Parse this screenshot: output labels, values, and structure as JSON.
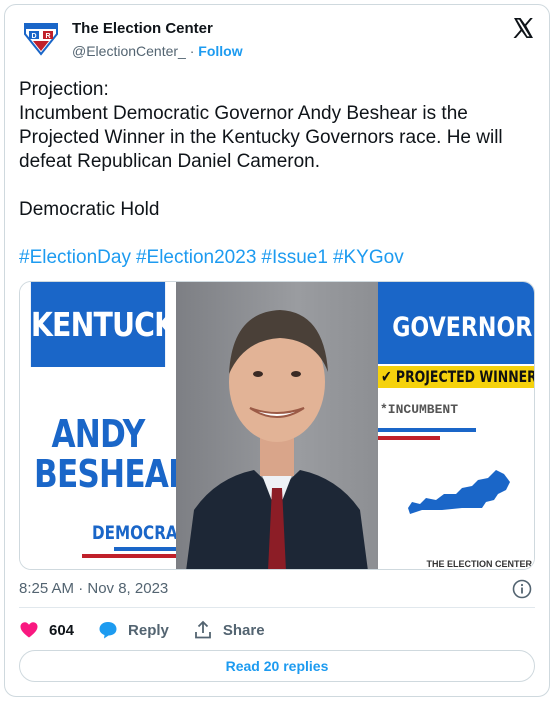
{
  "header": {
    "display_name": "The Election Center",
    "handle": "@ElectionCenter_",
    "separator": "·",
    "follow_label": "Follow"
  },
  "tweet": {
    "lines": [
      "Projection:",
      "Incumbent Democratic Governor Andy Beshear is the Projected Winner in the Kentucky Governors race. He will defeat Republican Daniel Cameron.",
      "",
      "Democratic Hold"
    ],
    "hashtags": [
      "#ElectionDay",
      "#Election2023",
      "#Issue1",
      "#KYGov"
    ]
  },
  "media": {
    "state_banner": "KENTUCKY",
    "first_name": "ANDY",
    "last_name": "BESHEAR",
    "party": "DEMOCRAT",
    "office": "GOVERNOR",
    "status_check": "✔",
    "status": "PROJECTED WINNER",
    "incumbent": "*INCUMBENT",
    "credit": "THE ELECTION CENTER",
    "colors": {
      "blue": "#1a66c8",
      "red": "#c0202a",
      "yellow": "#f5d20d"
    }
  },
  "meta": {
    "timestamp": "8:25 AM · Nov 8, 2023"
  },
  "actions": {
    "like_count": "604",
    "reply_label": "Reply",
    "share_label": "Share",
    "read_replies_label": "Read 20 replies"
  },
  "icons": {
    "avatar": "election-center-logo",
    "x": "x-logo-icon",
    "info": "info-icon",
    "like": "heart-icon",
    "reply": "speech-bubble-icon",
    "share": "share-icon"
  }
}
